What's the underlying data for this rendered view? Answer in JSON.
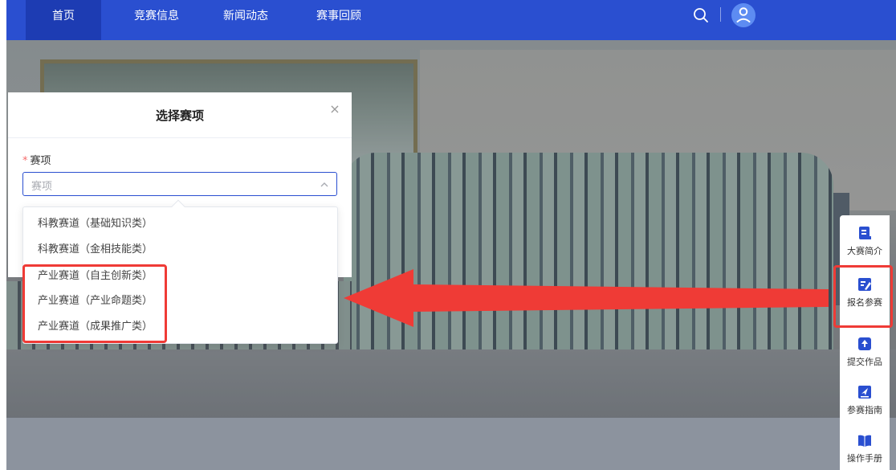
{
  "nav": {
    "items": [
      {
        "label": "首页",
        "active": true
      },
      {
        "label": "竞赛信息",
        "active": false
      },
      {
        "label": "新闻动态",
        "active": false
      },
      {
        "label": "赛事回顾",
        "active": false
      }
    ],
    "icons": {
      "search": "search-icon",
      "user": "user-icon"
    }
  },
  "sidebar": {
    "items": [
      {
        "label": "大赛简介",
        "icon": "document-icon"
      },
      {
        "label": "报名参赛",
        "icon": "edit-icon"
      },
      {
        "label": "提交作品",
        "icon": "upload-icon"
      },
      {
        "label": "参赛指南",
        "icon": "guide-icon"
      },
      {
        "label": "操作手册",
        "icon": "book-icon"
      }
    ]
  },
  "modal": {
    "title": "选择赛项",
    "field_label": "赛项",
    "required_mark": "*",
    "placeholder": "赛项",
    "close_glyph": "×"
  },
  "dropdown": {
    "options": [
      "科教赛道（基础知识类）",
      "科教赛道（金相技能类）",
      "产业赛道（自主创新类）",
      "产业赛道（产业命题类）",
      "产业赛道（成果推广类）"
    ]
  },
  "colors": {
    "primary": "#2a4fd0",
    "annotation": "#ef3b36",
    "required": "#f56c6c"
  }
}
